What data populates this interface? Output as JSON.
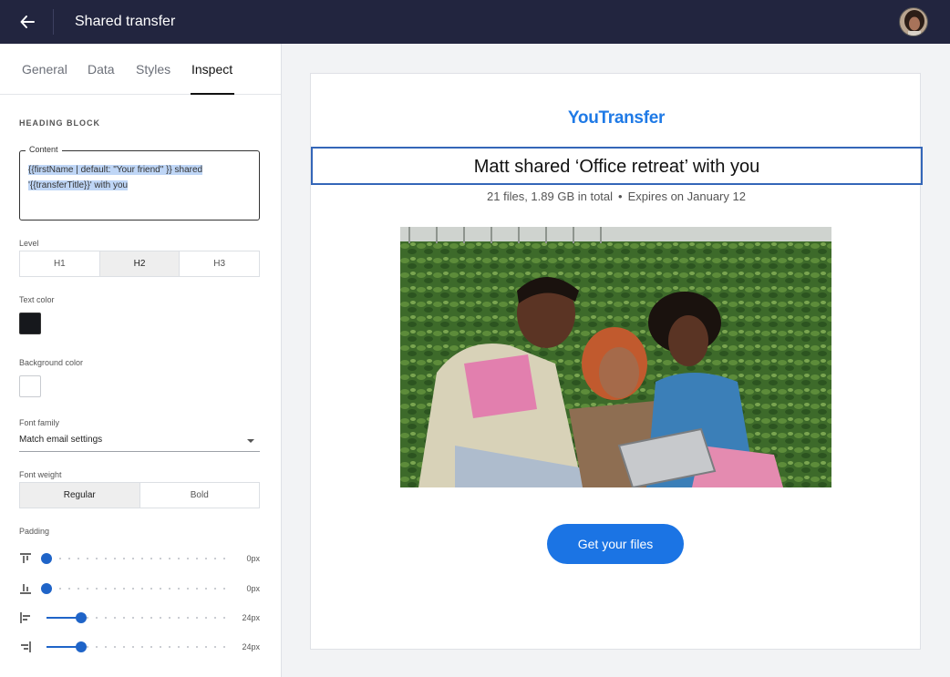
{
  "header": {
    "title": "Shared transfer",
    "back_icon": "arrow-left-icon",
    "avatar_icon": "user-avatar"
  },
  "sidebar": {
    "tabs": [
      {
        "label": "General",
        "active": false
      },
      {
        "label": "Data",
        "active": false
      },
      {
        "label": "Styles",
        "active": false
      },
      {
        "label": "Inspect",
        "active": true
      }
    ],
    "section_title": "HEADING BLOCK",
    "content": {
      "legend": "Content",
      "value_line1": "{{firstName | default: \"Your friend\" }} shared",
      "value_line2": "'{{transferTitle}}' with you"
    },
    "level": {
      "label": "Level",
      "options": [
        "H1",
        "H2",
        "H3"
      ],
      "selected": "H2"
    },
    "text_color": {
      "label": "Text color",
      "value": "#16181c"
    },
    "background_color": {
      "label": "Background color",
      "value": "#ffffff"
    },
    "font_family": {
      "label": "Font family",
      "value": "Match email settings",
      "icon": "caret-down-icon"
    },
    "font_weight": {
      "label": "Font weight",
      "options": [
        "Regular",
        "Bold"
      ],
      "selected": "Regular"
    },
    "padding": {
      "label": "Padding",
      "rows": [
        {
          "side": "top",
          "icon": "padding-top-icon",
          "value_label": "0px",
          "value": 0
        },
        {
          "side": "bottom",
          "icon": "padding-bottom-icon",
          "value_label": "0px",
          "value": 0
        },
        {
          "side": "left",
          "icon": "padding-left-icon",
          "value_label": "24px",
          "value": 24
        },
        {
          "side": "right",
          "icon": "padding-right-icon",
          "value_label": "24px",
          "value": 24
        }
      ],
      "max": 128
    }
  },
  "preview": {
    "brand": "YouTransfer",
    "heading": "Matt shared ‘Office retreat’ with you",
    "details": "21 files, 1.89 GB in total",
    "separator": "•",
    "expiry": "Expires on January 12",
    "button_label": "Get your files"
  },
  "colors": {
    "topbar": "#22253f",
    "accent": "#1f64c8",
    "cta": "#1b74e4",
    "brand": "#1f7ae6"
  }
}
